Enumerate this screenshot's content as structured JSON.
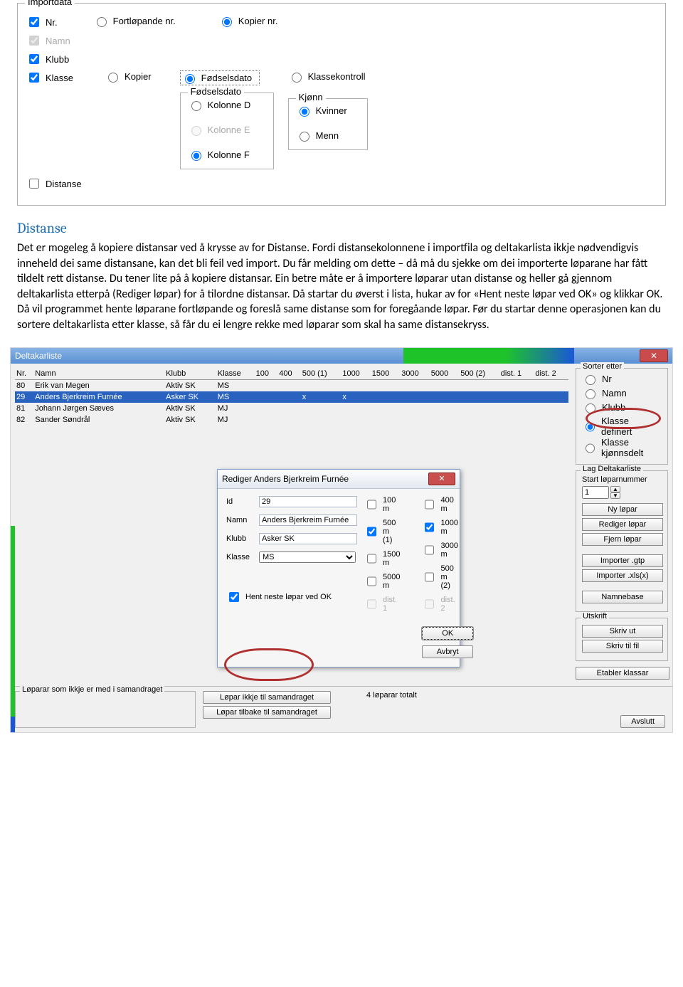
{
  "import": {
    "legend": "Importdata",
    "nr": "Nr.",
    "fortlop": "Fortløpande nr.",
    "kopier_nr": "Kopier nr.",
    "namn": "Namn",
    "klubb": "Klubb",
    "klasse": "Klasse",
    "kopier": "Kopier",
    "fodsel": "Fødselsdato",
    "klassekontroll": "Klassekontroll",
    "fodsel_legend": "Fødselsdato",
    "kol_d": "Kolonne D",
    "kol_e": "Kolonne E",
    "kol_f": "Kolonne F",
    "kjonn_legend": "Kjønn",
    "kvinner": "Kvinner",
    "menn": "Menn",
    "distanse": "Distanse"
  },
  "heading": "Distanse",
  "para": "Det er mogeleg å kopiere distansar ved å krysse av for Distanse. Fordi distansekolonnene i importfila og deltakarlista ikkje nødvendigvis inneheld dei same distansane, kan det bli feil ved import. Du får melding om dette – då må du sjekke om dei importerte løparane har fått tildelt rett distanse. Du tener lite på å kopiere distansar. Ein betre måte er å importere løparar utan distanse og heller gå gjennom deltakarlista etterpå (Rediger løpar) for å tilordne distansar. Då startar du øverst i lista, hukar av for «Hent neste løpar ved OK» og klikkar OK. Då vil programmet hente løparane fortløpande og foreslå same distanse som for foregåande løpar. Før du startar denne operasjonen kan du sortere deltakarlista etter klasse, så får du ei lengre rekke med løparar som skal ha same distansekryss.",
  "list": {
    "title": "Deltakarliste",
    "cols": [
      "Nr.",
      "Namn",
      "Klubb",
      "Klasse",
      "100",
      "400",
      "500 (1)",
      "1000",
      "1500",
      "3000",
      "5000",
      "500 (2)",
      "dist. 1",
      "dist. 2"
    ],
    "rows": [
      [
        "80",
        "Erik van Megen",
        "Aktiv SK",
        "MS",
        "",
        "",
        "",
        "",
        "",
        "",
        "",
        "",
        "",
        ""
      ],
      [
        "29",
        "Anders Bjerkreim Furnée",
        "Asker SK",
        "MS",
        "",
        "",
        "x",
        "x",
        "",
        "",
        "",
        "",
        "",
        ""
      ],
      [
        "81",
        "Johann Jørgen Sæves",
        "Aktiv SK",
        "MJ",
        "",
        "",
        "",
        "",
        "",
        "",
        "",
        "",
        "",
        ""
      ],
      [
        "82",
        "Sander Søndrål",
        "Aktiv SK",
        "MJ",
        "",
        "",
        "",
        "",
        "",
        "",
        "",
        "",
        "",
        ""
      ]
    ],
    "footer_box": "Løparar som ikkje er med i samandraget",
    "btn1": "Løpar ikkje til samandraget",
    "btn2": "Løpar tilbake til samandraget",
    "count": "4 løparar totalt",
    "avslutt": "Avslutt"
  },
  "sort": {
    "legend": "Sorter etter",
    "nr": "Nr",
    "namn": "Namn",
    "klubb": "Klubb",
    "kdef": "Klasse definert",
    "kkjonn": "Klasse kjønnsdelt"
  },
  "side": {
    "lag": "Lag Deltakarliste",
    "start": "Start løparnummer",
    "start_val": "1",
    "ny": "Ny løpar",
    "rediger": "Rediger løpar",
    "fjern": "Fjern løpar",
    "gtp": "Importer .gtp",
    "xls": "Importer .xls(x)",
    "namnbase": "Namnebase",
    "utskrift": "Utskrift",
    "skrivut": "Skriv ut",
    "skrivfil": "Skriv til fil",
    "etabler": "Etabler klassar"
  },
  "dlg": {
    "title": "Rediger Anders Bjerkreim Furnée",
    "id": "Id",
    "id_v": "29",
    "namn": "Namn",
    "namn_v": "Anders Bjerkreim Furnée",
    "klubb": "Klubb",
    "klubb_v": "Asker SK",
    "klasse": "Klasse",
    "klasse_v": "MS",
    "c100": "100 m",
    "c400": "400 m",
    "c500": "500 m (1)",
    "c1000": "1000 m",
    "c1500": "1500 m",
    "c3000": "3000 m",
    "c5000": "5000 m",
    "c500_2": "500 m (2)",
    "d1": "dist. 1",
    "d2": "dist. 2",
    "hent": "Hent neste løpar ved OK",
    "ok": "OK",
    "avbryt": "Avbryt"
  }
}
